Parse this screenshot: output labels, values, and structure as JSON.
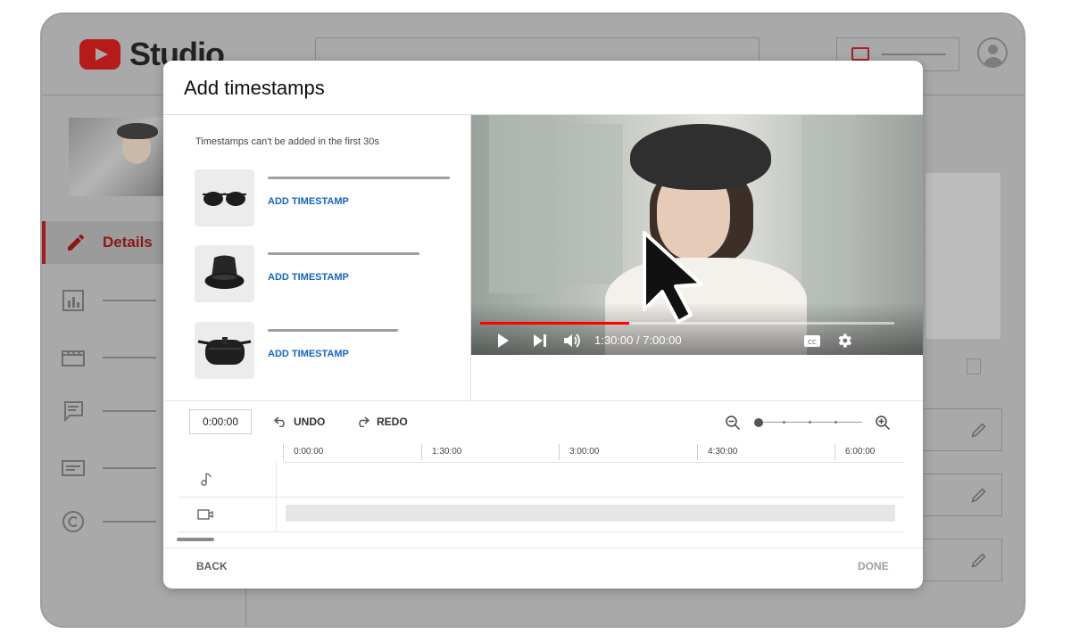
{
  "app": {
    "logo_text": "Studio"
  },
  "sidebar": {
    "active_label": "Details"
  },
  "modal": {
    "title": "Add timestamps",
    "note": "Timestamps can't be added in the first 30s",
    "items": [
      {
        "icon": "sunglasses-icon",
        "action": "ADD TIMESTAMP"
      },
      {
        "icon": "bucket-hat-icon",
        "action": "ADD TIMESTAMP"
      },
      {
        "icon": "waist-bag-icon",
        "action": "ADD TIMESTAMP"
      }
    ],
    "player": {
      "time_display": "1:30:00 / 7:00:00",
      "progress_fraction": 0.36,
      "controls": [
        "play-icon",
        "next-icon",
        "volume-icon",
        "captions-icon",
        "settings-icon"
      ]
    },
    "timeline": {
      "current_time": "0:00:00",
      "undo_label": "UNDO",
      "redo_label": "REDO",
      "ticks": [
        "0:00:00",
        "1:30:00",
        "3:00:00",
        "4:30:00",
        "6:00:00"
      ],
      "tracks": [
        "music-note-icon",
        "video-camera-icon"
      ]
    },
    "footer": {
      "back_label": "BACK",
      "done_label": "DONE"
    }
  },
  "colors": {
    "accent_blue": "#1565c0",
    "progress_red": "#ff0000",
    "brand_red": "#b51b1b"
  }
}
